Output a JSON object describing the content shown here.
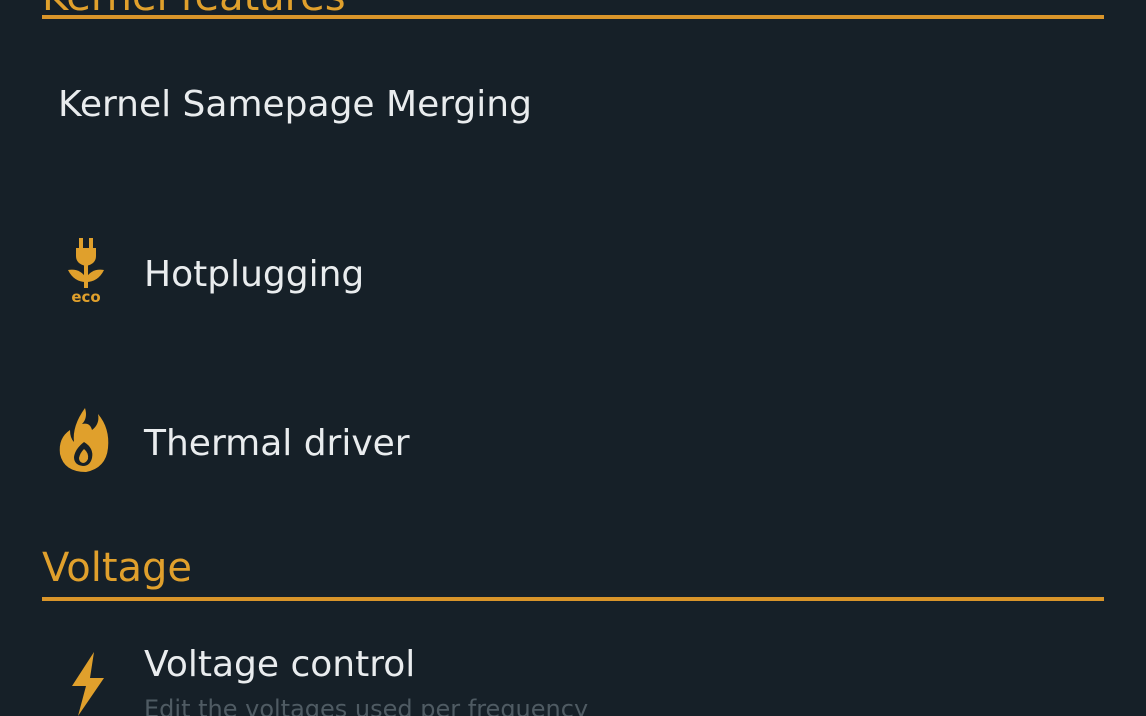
{
  "colors": {
    "background": "#162028",
    "accent": "#e0a02c",
    "text_primary": "#e9ecee",
    "text_secondary": "#4f5b63"
  },
  "sections": [
    {
      "header": "Kernel features",
      "items": [
        {
          "title": "Kernel Samepage Merging",
          "icon": ""
        },
        {
          "title": "Hotplugging",
          "icon": "eco-plug-icon"
        },
        {
          "title": "Thermal driver",
          "icon": "flame-icon"
        }
      ]
    },
    {
      "header": "Voltage",
      "items": [
        {
          "title": "Voltage control",
          "subtitle": "Edit the voltages used per frequency",
          "icon": "lightning-bolt-icon"
        }
      ]
    }
  ]
}
